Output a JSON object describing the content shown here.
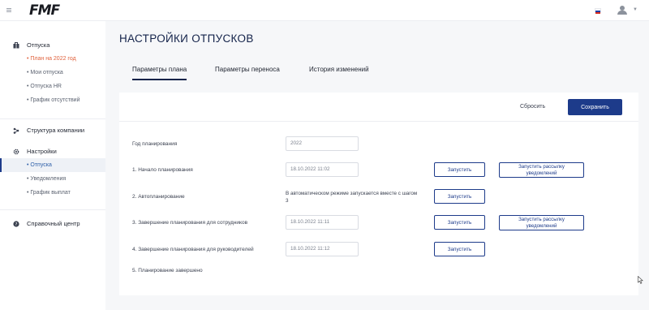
{
  "app": {
    "logo": "FMF",
    "language": "ru",
    "flag_colors": [
      "#ffffff",
      "#1c3fa8",
      "#d52b1e"
    ]
  },
  "sidebar": {
    "sections": [
      {
        "label": "Отпуска",
        "icon": "briefcase-icon",
        "items": [
          {
            "label": "• План на 2022 год",
            "state": "current"
          },
          {
            "label": "• Мои отпуска"
          },
          {
            "label": "• Отпуска HR"
          },
          {
            "label": "• График отсутствий"
          }
        ]
      },
      {
        "label": "Структура компании",
        "icon": "org-structure-icon",
        "items": []
      },
      {
        "label": "Настройки",
        "icon": "gear-icon",
        "items": [
          {
            "label": "• Отпуска",
            "state": "active"
          },
          {
            "label": "• Уведомления"
          },
          {
            "label": "• График выплат"
          }
        ]
      },
      {
        "label": "Справочный центр",
        "icon": "help-icon",
        "items": []
      }
    ]
  },
  "page": {
    "title": "НАСТРОЙКИ ОТПУСКОВ",
    "tabs": [
      {
        "label": "Параметры плана",
        "active": true
      },
      {
        "label": "Параметры переноса",
        "active": false
      },
      {
        "label": "История изменений",
        "active": false
      }
    ],
    "actions": {
      "reset_label": "Сбросить",
      "save_label": "Сохранить"
    },
    "rows": [
      {
        "label": "Год планирования",
        "value": "2022"
      },
      {
        "label": "1. Начало планирования",
        "value": "18.10.2022 11:02",
        "run_label": "Запустить",
        "mail_label": "Запустить рассылку уведомлений"
      },
      {
        "label": "2. Автопланирование",
        "note": "В автоматическом режиме запускается вместе с шагом 3",
        "run_label": "Запустить"
      },
      {
        "label": "3. Завершение планирования для сотрудников",
        "value": "18.10.2022 11:11",
        "run_label": "Запустить",
        "mail_label": "Запустить рассылку уведомлений"
      },
      {
        "label": "4. Завершение планирования для руководителей",
        "value": "18.10.2022 11:12",
        "run_label": "Запустить"
      },
      {
        "label": "5. Планирование завершено"
      }
    ]
  },
  "colors": {
    "primary": "#1d3b8a",
    "accent_red": "#e0623d",
    "title": "#14234a",
    "background": "#f6f7f9"
  }
}
